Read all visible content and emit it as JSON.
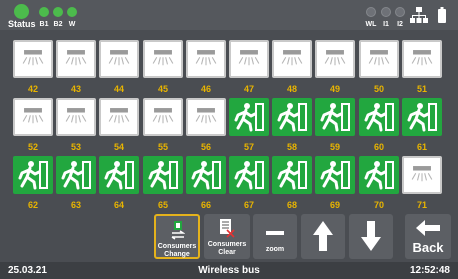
{
  "header": {
    "status_label": "Status",
    "indicators_left": [
      {
        "label": "B1",
        "state": "on"
      },
      {
        "label": "B2",
        "state": "on"
      },
      {
        "label": "W",
        "state": "on"
      }
    ],
    "indicators_right": [
      {
        "label": "WL",
        "state": "off"
      },
      {
        "label": "I1",
        "state": "off"
      },
      {
        "label": "I2",
        "state": "off"
      }
    ],
    "network_icon": "network-icon",
    "battery_icon": "battery-icon"
  },
  "luminaires": [
    {
      "number": "42",
      "type": "lamp"
    },
    {
      "number": "43",
      "type": "lamp"
    },
    {
      "number": "44",
      "type": "lamp"
    },
    {
      "number": "45",
      "type": "lamp"
    },
    {
      "number": "46",
      "type": "lamp"
    },
    {
      "number": "47",
      "type": "lamp"
    },
    {
      "number": "48",
      "type": "lamp"
    },
    {
      "number": "49",
      "type": "lamp"
    },
    {
      "number": "50",
      "type": "lamp"
    },
    {
      "number": "51",
      "type": "lamp"
    },
    {
      "number": "52",
      "type": "lamp"
    },
    {
      "number": "53",
      "type": "lamp"
    },
    {
      "number": "54",
      "type": "lamp"
    },
    {
      "number": "55",
      "type": "lamp"
    },
    {
      "number": "56",
      "type": "lamp"
    },
    {
      "number": "57",
      "type": "exit"
    },
    {
      "number": "58",
      "type": "exit"
    },
    {
      "number": "59",
      "type": "exit"
    },
    {
      "number": "60",
      "type": "exit"
    },
    {
      "number": "61",
      "type": "exit"
    },
    {
      "number": "62",
      "type": "exit"
    },
    {
      "number": "63",
      "type": "exit"
    },
    {
      "number": "64",
      "type": "exit"
    },
    {
      "number": "65",
      "type": "exit"
    },
    {
      "number": "66",
      "type": "exit"
    },
    {
      "number": "67",
      "type": "exit"
    },
    {
      "number": "68",
      "type": "exit"
    },
    {
      "number": "69",
      "type": "exit"
    },
    {
      "number": "70",
      "type": "exit"
    },
    {
      "number": "71",
      "type": "lamp"
    }
  ],
  "toolbar": {
    "consumers_change": "Consumers Change",
    "consumers_clear": "Consumers Clear",
    "zoom": "zoom",
    "back": "Back"
  },
  "statusbar": {
    "date": "25.03.21",
    "title": "Wireless bus",
    "time": "12:52:48"
  },
  "colors": {
    "accent": "#e4b21c",
    "number": "#e8b400",
    "exit_green": "#22a73f",
    "led_on": "#4cbb4c"
  }
}
